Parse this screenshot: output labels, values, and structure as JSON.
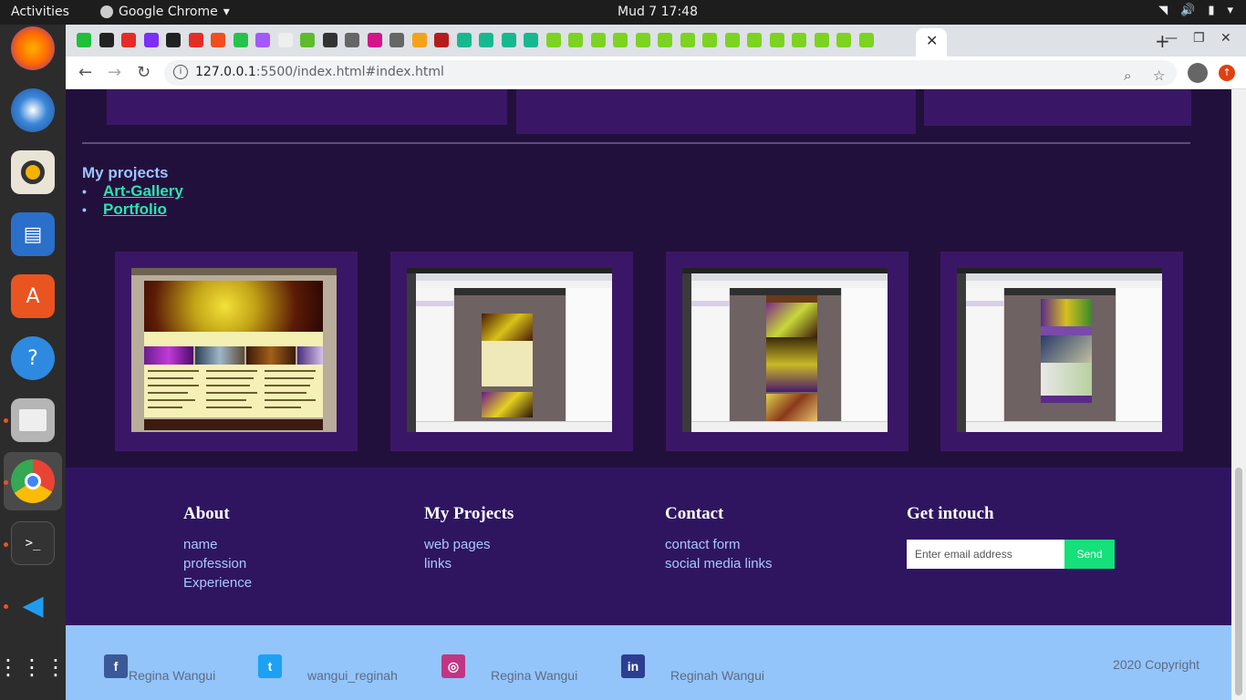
{
  "topbar": {
    "activities": "Activities",
    "app_name": "Google Chrome",
    "clock": "Mud 7  17:48"
  },
  "browser": {
    "url_host": "127.0.0.1",
    "url_path": ":5500/index.html#index.html"
  },
  "page": {
    "projects": {
      "heading": "My projects",
      "items": [
        "Art-Gallery",
        "Portfolio"
      ]
    },
    "footer": {
      "about": {
        "title": "About",
        "links": [
          "name",
          "profession",
          "Experience"
        ]
      },
      "my_projects": {
        "title": "My Projects",
        "links": [
          "web pages",
          "links"
        ]
      },
      "contact": {
        "title": "Contact",
        "links": [
          "contact form",
          "social media links"
        ]
      },
      "get_in_touch": {
        "title": "Get intouch",
        "email_placeholder": "Enter email address",
        "send_label": "Send"
      }
    },
    "bottom": {
      "social": [
        {
          "icon": "facebook-icon",
          "name": "Regina Wangui",
          "color": "#3b5998"
        },
        {
          "icon": "twitter-icon",
          "name": "wangui_reginah",
          "color": "#1da1f2"
        },
        {
          "icon": "instagram-icon",
          "name": "Regina Wangui",
          "color": "#c13584"
        },
        {
          "icon": "linkedin-icon",
          "name": "Reginah Wangui",
          "color": "#2c3e91"
        }
      ],
      "copyright": "2020 Copyright"
    }
  },
  "colors": {
    "page_bg": "#22103c",
    "card_bg": "#3a1766",
    "footer_bg": "#2f1560",
    "bottom_bg": "#93c5fb",
    "link_green": "#2de3b2",
    "send_green": "#15e07a"
  }
}
